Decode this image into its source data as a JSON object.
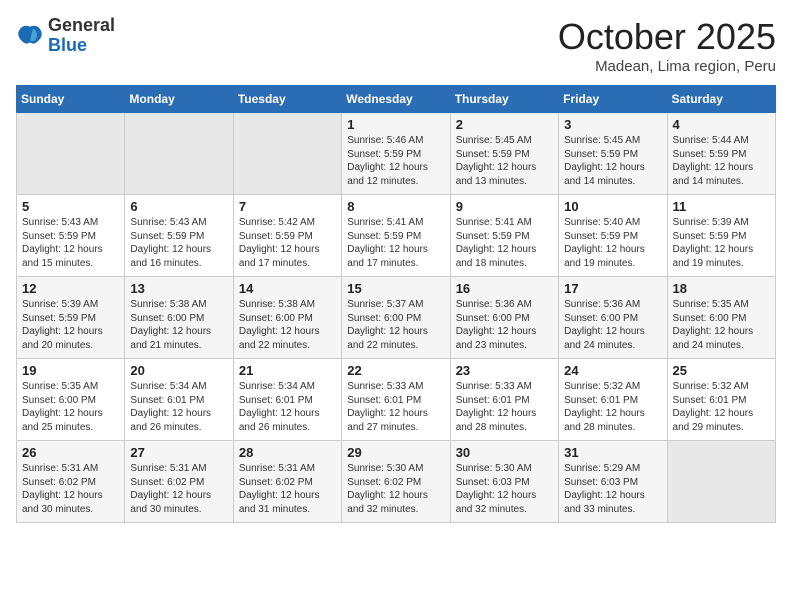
{
  "header": {
    "logo": {
      "general": "General",
      "blue": "Blue"
    },
    "title": "October 2025",
    "location": "Madean, Lima region, Peru"
  },
  "calendar": {
    "days_of_week": [
      "Sunday",
      "Monday",
      "Tuesday",
      "Wednesday",
      "Thursday",
      "Friday",
      "Saturday"
    ],
    "weeks": [
      [
        {
          "day": "",
          "content": ""
        },
        {
          "day": "",
          "content": ""
        },
        {
          "day": "",
          "content": ""
        },
        {
          "day": "1",
          "content": "Sunrise: 5:46 AM\nSunset: 5:59 PM\nDaylight: 12 hours\nand 12 minutes."
        },
        {
          "day": "2",
          "content": "Sunrise: 5:45 AM\nSunset: 5:59 PM\nDaylight: 12 hours\nand 13 minutes."
        },
        {
          "day": "3",
          "content": "Sunrise: 5:45 AM\nSunset: 5:59 PM\nDaylight: 12 hours\nand 14 minutes."
        },
        {
          "day": "4",
          "content": "Sunrise: 5:44 AM\nSunset: 5:59 PM\nDaylight: 12 hours\nand 14 minutes."
        }
      ],
      [
        {
          "day": "5",
          "content": "Sunrise: 5:43 AM\nSunset: 5:59 PM\nDaylight: 12 hours\nand 15 minutes."
        },
        {
          "day": "6",
          "content": "Sunrise: 5:43 AM\nSunset: 5:59 PM\nDaylight: 12 hours\nand 16 minutes."
        },
        {
          "day": "7",
          "content": "Sunrise: 5:42 AM\nSunset: 5:59 PM\nDaylight: 12 hours\nand 17 minutes."
        },
        {
          "day": "8",
          "content": "Sunrise: 5:41 AM\nSunset: 5:59 PM\nDaylight: 12 hours\nand 17 minutes."
        },
        {
          "day": "9",
          "content": "Sunrise: 5:41 AM\nSunset: 5:59 PM\nDaylight: 12 hours\nand 18 minutes."
        },
        {
          "day": "10",
          "content": "Sunrise: 5:40 AM\nSunset: 5:59 PM\nDaylight: 12 hours\nand 19 minutes."
        },
        {
          "day": "11",
          "content": "Sunrise: 5:39 AM\nSunset: 5:59 PM\nDaylight: 12 hours\nand 19 minutes."
        }
      ],
      [
        {
          "day": "12",
          "content": "Sunrise: 5:39 AM\nSunset: 5:59 PM\nDaylight: 12 hours\nand 20 minutes."
        },
        {
          "day": "13",
          "content": "Sunrise: 5:38 AM\nSunset: 6:00 PM\nDaylight: 12 hours\nand 21 minutes."
        },
        {
          "day": "14",
          "content": "Sunrise: 5:38 AM\nSunset: 6:00 PM\nDaylight: 12 hours\nand 22 minutes."
        },
        {
          "day": "15",
          "content": "Sunrise: 5:37 AM\nSunset: 6:00 PM\nDaylight: 12 hours\nand 22 minutes."
        },
        {
          "day": "16",
          "content": "Sunrise: 5:36 AM\nSunset: 6:00 PM\nDaylight: 12 hours\nand 23 minutes."
        },
        {
          "day": "17",
          "content": "Sunrise: 5:36 AM\nSunset: 6:00 PM\nDaylight: 12 hours\nand 24 minutes."
        },
        {
          "day": "18",
          "content": "Sunrise: 5:35 AM\nSunset: 6:00 PM\nDaylight: 12 hours\nand 24 minutes."
        }
      ],
      [
        {
          "day": "19",
          "content": "Sunrise: 5:35 AM\nSunset: 6:00 PM\nDaylight: 12 hours\nand 25 minutes."
        },
        {
          "day": "20",
          "content": "Sunrise: 5:34 AM\nSunset: 6:01 PM\nDaylight: 12 hours\nand 26 minutes."
        },
        {
          "day": "21",
          "content": "Sunrise: 5:34 AM\nSunset: 6:01 PM\nDaylight: 12 hours\nand 26 minutes."
        },
        {
          "day": "22",
          "content": "Sunrise: 5:33 AM\nSunset: 6:01 PM\nDaylight: 12 hours\nand 27 minutes."
        },
        {
          "day": "23",
          "content": "Sunrise: 5:33 AM\nSunset: 6:01 PM\nDaylight: 12 hours\nand 28 minutes."
        },
        {
          "day": "24",
          "content": "Sunrise: 5:32 AM\nSunset: 6:01 PM\nDaylight: 12 hours\nand 28 minutes."
        },
        {
          "day": "25",
          "content": "Sunrise: 5:32 AM\nSunset: 6:01 PM\nDaylight: 12 hours\nand 29 minutes."
        }
      ],
      [
        {
          "day": "26",
          "content": "Sunrise: 5:31 AM\nSunset: 6:02 PM\nDaylight: 12 hours\nand 30 minutes."
        },
        {
          "day": "27",
          "content": "Sunrise: 5:31 AM\nSunset: 6:02 PM\nDaylight: 12 hours\nand 30 minutes."
        },
        {
          "day": "28",
          "content": "Sunrise: 5:31 AM\nSunset: 6:02 PM\nDaylight: 12 hours\nand 31 minutes."
        },
        {
          "day": "29",
          "content": "Sunrise: 5:30 AM\nSunset: 6:02 PM\nDaylight: 12 hours\nand 32 minutes."
        },
        {
          "day": "30",
          "content": "Sunrise: 5:30 AM\nSunset: 6:03 PM\nDaylight: 12 hours\nand 32 minutes."
        },
        {
          "day": "31",
          "content": "Sunrise: 5:29 AM\nSunset: 6:03 PM\nDaylight: 12 hours\nand 33 minutes."
        },
        {
          "day": "",
          "content": ""
        }
      ]
    ]
  }
}
